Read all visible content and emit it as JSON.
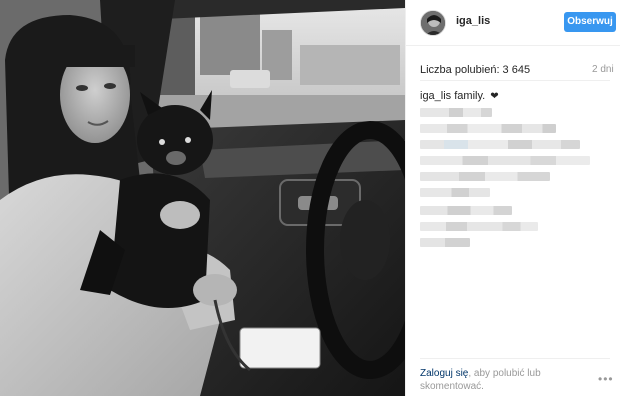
{
  "post": {
    "username": "iga_lis",
    "follow_label": "Obserwuj",
    "likes_text": "Liczba polubień: 3 645",
    "date_text": "2 dni",
    "caption": "iga_lis family.",
    "caption_heart": "❤",
    "login_link": "Zaloguj się",
    "login_rest": ", aby polubić lub skomentować.",
    "more_icon": "more-dots-icon"
  },
  "colors": {
    "accent": "#3897f0",
    "login_link": "#003569",
    "muted_text": "#999999"
  }
}
